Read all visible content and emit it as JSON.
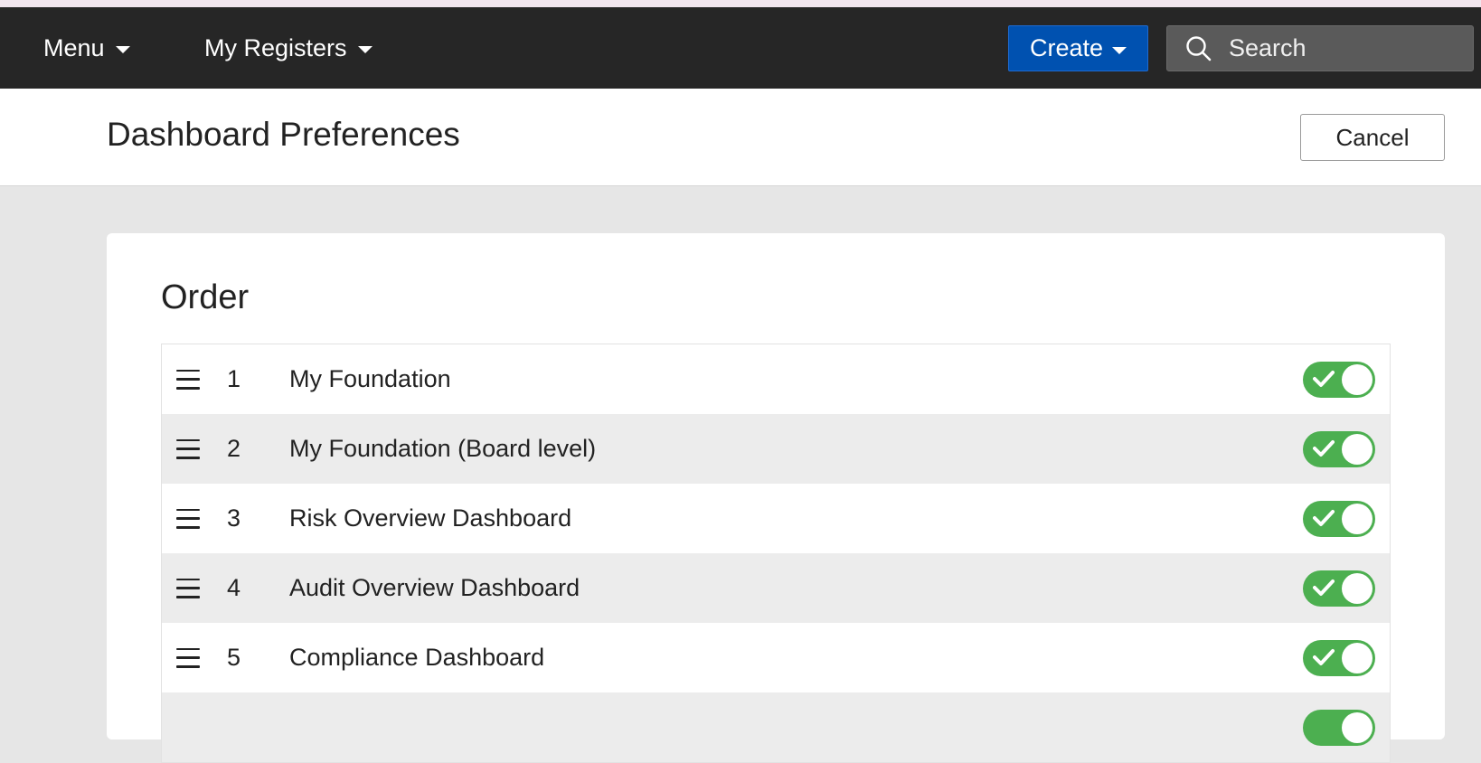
{
  "nav": {
    "menu_label": "Menu",
    "registers_label": "My Registers",
    "create_label": "Create",
    "search_placeholder": "Search"
  },
  "header": {
    "title": "Dashboard Preferences",
    "cancel_label": "Cancel"
  },
  "order_section": {
    "title": "Order",
    "items": [
      {
        "num": "1",
        "label": "My Foundation",
        "enabled": true
      },
      {
        "num": "2",
        "label": "My Foundation (Board level)",
        "enabled": true
      },
      {
        "num": "3",
        "label": "Risk Overview Dashboard",
        "enabled": true
      },
      {
        "num": "4",
        "label": "Audit Overview Dashboard",
        "enabled": true
      },
      {
        "num": "5",
        "label": "Compliance Dashboard",
        "enabled": true
      }
    ]
  },
  "colors": {
    "navbar": "#262626",
    "create_button": "#0051b0",
    "toggle_on": "#4caf50"
  }
}
